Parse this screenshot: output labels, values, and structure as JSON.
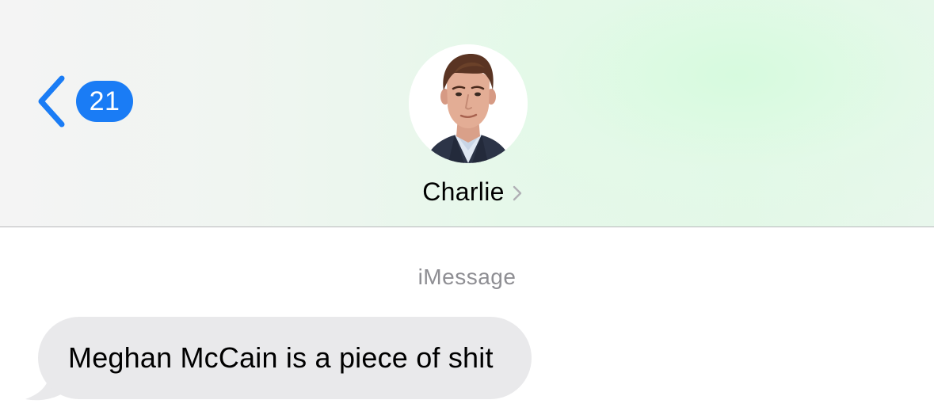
{
  "header": {
    "back_icon": "chevron-left-icon",
    "unread_count": "21",
    "contact_name": "Charlie",
    "contact_chevron_icon": "chevron-right-icon",
    "avatar": "contact-photo",
    "accent_color": "#1a7cf5"
  },
  "conversation": {
    "service_label": "iMessage",
    "messages": [
      {
        "direction": "incoming",
        "text": "Meghan McCain is a piece of shit",
        "bubble_color": "#e9e9eb"
      }
    ]
  }
}
